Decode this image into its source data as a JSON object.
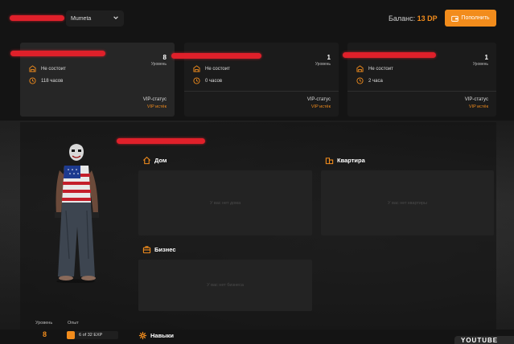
{
  "header": {
    "server_value": "Mumeta",
    "balance_label": "Баланс:",
    "balance_value": "13 DP",
    "topup_label": "Пополнить"
  },
  "cards": [
    {
      "level": "8",
      "level_label": "Уровень",
      "org": "Не состоит",
      "hours": "118 часов",
      "vip_label": "VIP-статус",
      "vip_value": "VIP истёк"
    },
    {
      "level": "1",
      "level_label": "Уровень",
      "org": "Не состоит",
      "hours": "0 часов",
      "vip_label": "VIP-статус",
      "vip_value": "VIP истёк"
    },
    {
      "level": "1",
      "level_label": "Уровень",
      "org": "Не состоит",
      "hours": "2 часа",
      "vip_label": "VIP-статус",
      "vip_value": "VIP истёк"
    }
  ],
  "sections": {
    "house": {
      "title": "Дом",
      "empty": "У вас нет дома"
    },
    "apartment": {
      "title": "Квартира",
      "empty": "У вас нет квартиры"
    },
    "business": {
      "title": "Бизнес",
      "empty": "У вас нет бизнеса"
    },
    "skills": {
      "title": "Навыки"
    }
  },
  "stats": {
    "level_label": "Уровень",
    "exp_label": "Опыт",
    "level_value": "8",
    "exp_value": "6 of 32 EXP"
  },
  "watermark": "YOUTUBE",
  "colors": {
    "accent": "#f28c1c",
    "redaction": "#e0202a",
    "card_bg": "#1b1b1b",
    "page_bg": "#141414"
  }
}
